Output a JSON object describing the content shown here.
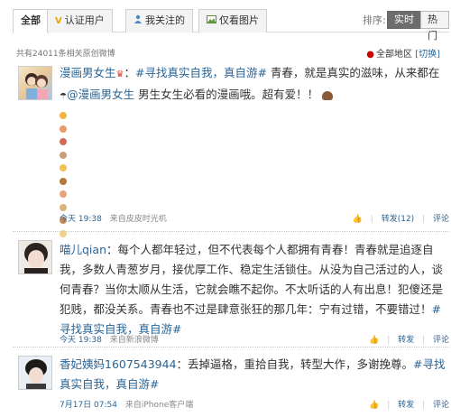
{
  "tabs": [
    {
      "label": "全部",
      "icon": ""
    },
    {
      "label": "认证用户",
      "icon": "v-verified-icon"
    },
    {
      "label": "我关注的",
      "icon": "people-icon"
    },
    {
      "label": "仅看图片",
      "icon": "picture-icon"
    }
  ],
  "sort": {
    "label": "排序:",
    "options": [
      "实时",
      "热门"
    ],
    "selected": "实时"
  },
  "results_meta": "共有24011条相关原创微博",
  "region": {
    "label": "全部地区",
    "switch": "[切换]"
  },
  "posts": [
    {
      "user": "漫画男女生",
      "segments": {
        "tag": "#寻找真实自我，真自游#",
        "text1": " 青春，就是真实的滋味，从来都在",
        "mention": "@漫画男女生",
        "text2": " 男生女生必看的漫画哦。超有爱！！"
      },
      "time": "今天 19:38",
      "source": "来自皮皮时光机",
      "forward": "转发(12)",
      "comment": "评论"
    },
    {
      "user": "喵儿qian",
      "segments": {
        "text1": "：每个人都年轻过，但不代表每个人都拥有青春！青春就是追逐自我，多数人青葱岁月，接优厚工作、稳定生活锁住。从没为自己活过的人，谈何青春？当你太顺从生活，它就会瞧不起你。不太听话的人有出息！犯傻还是犯贱，都没关系。青春也不过是肆意张狂的那几年：宁有过错，不要错过！",
        "tag": "#寻找真实自我，真自游#"
      },
      "time": "今天 19:38",
      "source": "来自新浪微博",
      "forward": "转发",
      "comment": "评论"
    },
    {
      "user": "香妃姨妈1607543944",
      "segments": {
        "text1": "：丢掉逼格，重拾自我，转型大作，多谢挽尊。",
        "tag": "#寻找真实自我，真自游#"
      },
      "time": "7月17日 07:54",
      "source": "来自iPhone客户端",
      "forward": "转发",
      "comment": "评论"
    }
  ],
  "colors": {
    "link": "#2a6496",
    "accent_red": "#cc0000",
    "sort_active_bg": "#6d6d6d"
  }
}
